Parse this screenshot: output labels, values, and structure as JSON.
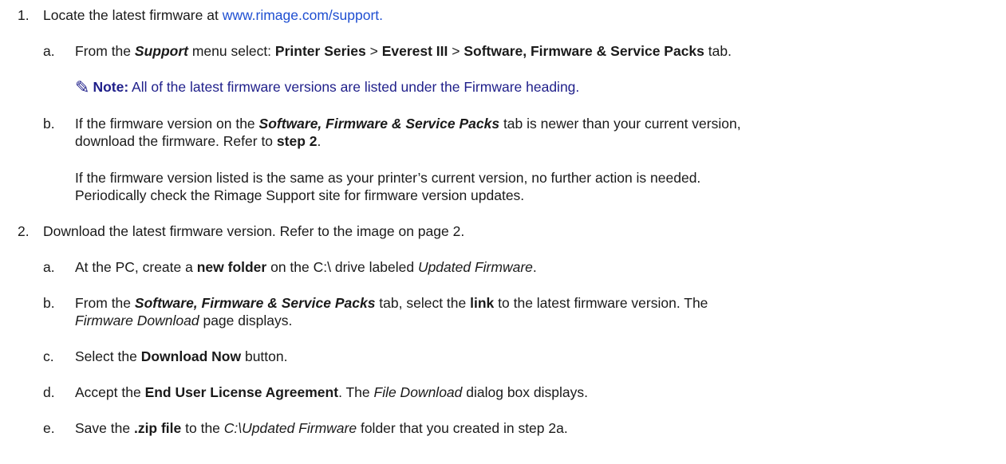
{
  "colors": {
    "link": "#1f4fd1",
    "note": "#1f1f8a",
    "text": "#1a1a1a"
  },
  "step1": {
    "num": "1.",
    "text": "Locate the latest firmware at ",
    "link": "www.rimage.com/support.",
    "a": {
      "label": "a.",
      "t1": "From the ",
      "b1": "Support",
      "t2": " menu select: ",
      "b2": "Printer Series",
      "t3": " > ",
      "b3": "Everest III",
      "t4": " > ",
      "b4": "Software, Firmware & Service Packs",
      "t5": " tab."
    },
    "note": {
      "icon": "pencil-icon",
      "label": "Note:",
      "text": " All of the latest firmware versions are listed under the Firmware heading."
    },
    "b": {
      "label": "b.",
      "t1": "If the firmware version on the ",
      "b1": "Software, Firmware & Service Packs",
      "t2": " tab is newer than your current version,",
      "line2a": "download the firmware. Refer to ",
      "line2b": "step 2",
      "line2c": ".",
      "p2line1": "If the firmware version listed is the same as your printer’s current version, no further action is needed.",
      "p2line2": "Periodically check the Rimage Support site for firmware version updates."
    }
  },
  "step2": {
    "num": "2.",
    "text": "Download the latest firmware version. Refer to the image on page 2.",
    "a": {
      "label": "a.",
      "t1": "At the PC, create a ",
      "b1": "new folder",
      "t2": " on the C:\\ drive labeled ",
      "i1": "Updated Firmware",
      "t3": "."
    },
    "b": {
      "label": "b.",
      "t1": "From the ",
      "b1": "Software, Firmware & Service Packs",
      "t2": " tab, select the ",
      "b2": "link",
      "t3": " to the latest firmware version. The",
      "i1": "Firmware Download",
      "t4": " page displays."
    },
    "c": {
      "label": "c.",
      "t1": "Select the ",
      "b1": "Download Now",
      "t2": " button."
    },
    "d": {
      "label": "d.",
      "t1": "Accept the ",
      "b1": "End User License Agreement",
      "t2": ". The ",
      "i1": "File Download",
      "t3": " dialog box displays."
    },
    "e": {
      "label": "e.",
      "t1": "Save the ",
      "b1": ".zip file",
      "t2": " to the ",
      "i1": "C:\\Updated Firmware",
      "t3": " folder that you created in step 2a."
    }
  }
}
